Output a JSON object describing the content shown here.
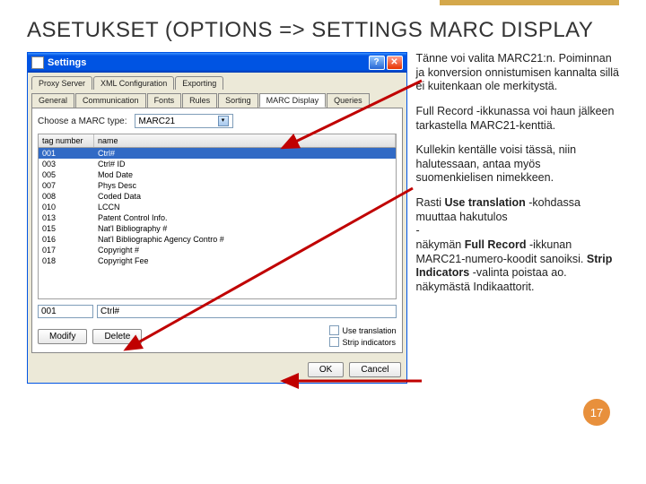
{
  "title": "ASETUKSET (OPTIONS => SETTINGS MARC DISPLAY",
  "window": {
    "title": "Settings",
    "tabs_upper": [
      "Proxy Server",
      "XML Configuration",
      "Exporting"
    ],
    "tabs_lower": [
      "General",
      "Communication",
      "Fonts",
      "Rules",
      "Sorting",
      "MARC Display",
      "Queries"
    ],
    "active_tab": "MARC Display",
    "choose_label": "Choose a MARC type:",
    "marc_type": "MARC21",
    "columns": {
      "tag": "tag number",
      "name": "name"
    },
    "rows": [
      {
        "tag": "001",
        "name": "Ctrl#"
      },
      {
        "tag": "003",
        "name": "Ctrl# ID"
      },
      {
        "tag": "005",
        "name": "Mod Date"
      },
      {
        "tag": "007",
        "name": "Phys Desc"
      },
      {
        "tag": "008",
        "name": "Coded Data"
      },
      {
        "tag": "010",
        "name": "LCCN"
      },
      {
        "tag": "013",
        "name": "Patent Control Info."
      },
      {
        "tag": "015",
        "name": "Nat'l Bibliography #"
      },
      {
        "tag": "016",
        "name": "Nat'l Bibliographic Agency Contro #"
      },
      {
        "tag": "017",
        "name": "Copyright #"
      },
      {
        "tag": "018",
        "name": "Copyright Fee"
      }
    ],
    "edit": {
      "tag": "001",
      "name": "Ctrl#"
    },
    "buttons": {
      "modify": "Modify",
      "delete": "Delete",
      "ok": "OK",
      "cancel": "Cancel"
    },
    "checks": {
      "trans": "Use translation",
      "strip": "Strip indicators"
    }
  },
  "side": {
    "p1": "Tänne voi valita MARC21:n. Poiminnan ja konversion onnistumisen kannalta sillä ei kuitenkaan ole merkitystä.",
    "p2": "Full Record -ikkunassa voi haun jälkeen tarkastella MARC21-kenttiä.",
    "p3": "Kullekin kentälle voisi tässä, niin halutessaan, antaa myös suomenkielisen nimekkeen.",
    "p4a": "Rasti ",
    "p4b": "Use translation",
    "p4c": " -kohdassa muuttaa hakutulos",
    "p4d": "-",
    "p4e": "näkymän ",
    "p4f": "Full Record",
    "p4g": " -ikkunan MARC21-numero-koodit sanoiksi. ",
    "p4h": "Strip Indicators",
    "p4i": " -valinta poistaa ao. näkymästä Indikaattorit."
  },
  "badge": "17"
}
